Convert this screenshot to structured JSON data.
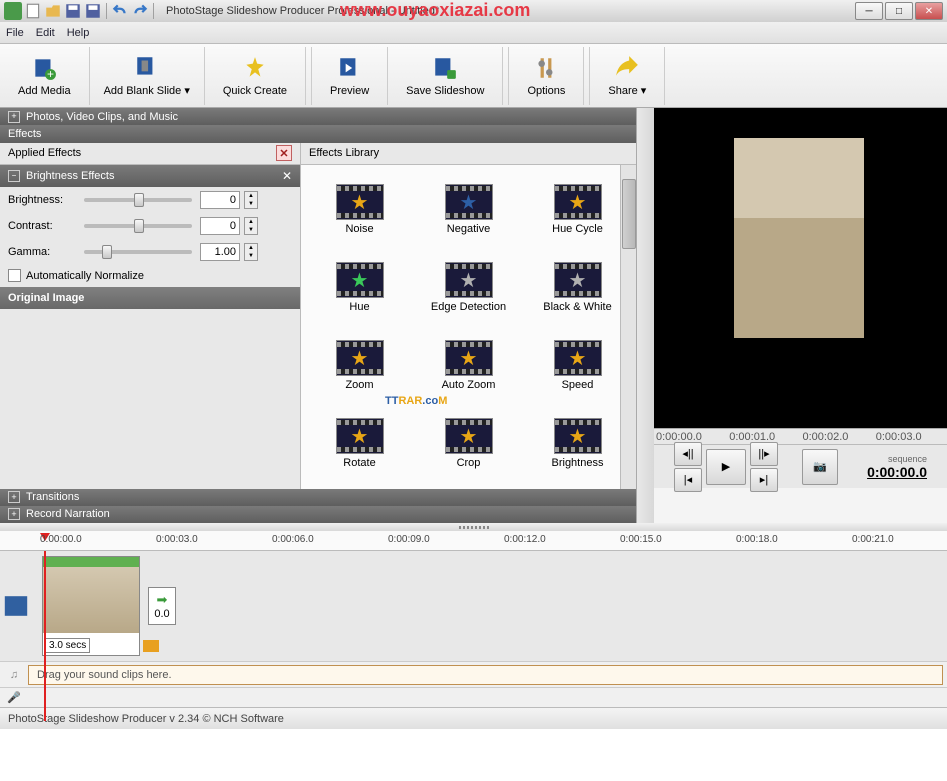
{
  "watermarks": {
    "url": "www.ouyaoxiazai.com",
    "brand": "TTRAR.coM"
  },
  "title": "PhotoStage Slideshow Producer Professional - Untitled*",
  "menu": {
    "file": "File",
    "edit": "Edit",
    "help": "Help"
  },
  "toolbar": {
    "add_media": "Add Media",
    "add_blank_slide": "Add Blank Slide",
    "quick_create": "Quick Create",
    "preview": "Preview",
    "save_slideshow": "Save Slideshow",
    "options": "Options",
    "share": "Share"
  },
  "sections": {
    "photos": "Photos, Video Clips, and Music",
    "effects": "Effects",
    "transitions": "Transitions",
    "record_narration": "Record Narration"
  },
  "applied": {
    "header": "Applied Effects",
    "brightness_hdr": "Brightness Effects",
    "brightness_lbl": "Brightness:",
    "brightness_val": "0",
    "contrast_lbl": "Contrast:",
    "contrast_val": "0",
    "gamma_lbl": "Gamma:",
    "gamma_val": "1.00",
    "auto_normalize": "Automatically Normalize",
    "original_image": "Original Image"
  },
  "library": {
    "header": "Effects Library",
    "items": [
      "Brightness",
      "Crop",
      "Rotate",
      "Speed",
      "Auto Zoom",
      "Zoom",
      "Black & White",
      "Edge Detection",
      "Hue",
      "Hue Cycle",
      "Negative",
      "Noise"
    ],
    "star_colors": [
      "#e8a616",
      "#e8a616",
      "#e8a616",
      "#e8a616",
      "#e8a616",
      "#e8a616",
      "#b0b0b0",
      "#b0b0b0",
      "#3ac85a",
      "#e8a616",
      "#2d5fa5",
      "#e8a616"
    ]
  },
  "preview": {
    "ruler": [
      "0:00:00.0",
      "0:00:01.0",
      "0:00:02.0",
      "0:00:03.0"
    ],
    "sequence_label": "sequence",
    "time": "0:00:00.0"
  },
  "timeline": {
    "ruler": [
      "0:00:00.0",
      "0:00:03.0",
      "0:00:06.0",
      "0:00:09.0",
      "0:00:12.0",
      "0:00:15.0",
      "0:00:18.0",
      "0:00:21.0"
    ],
    "clip_duration": "3.0 secs",
    "trans_duration": "0.0",
    "sound_placeholder": "Drag your sound clips here."
  },
  "status": "PhotoStage Slideshow Producer v 2.34 © NCH Software"
}
